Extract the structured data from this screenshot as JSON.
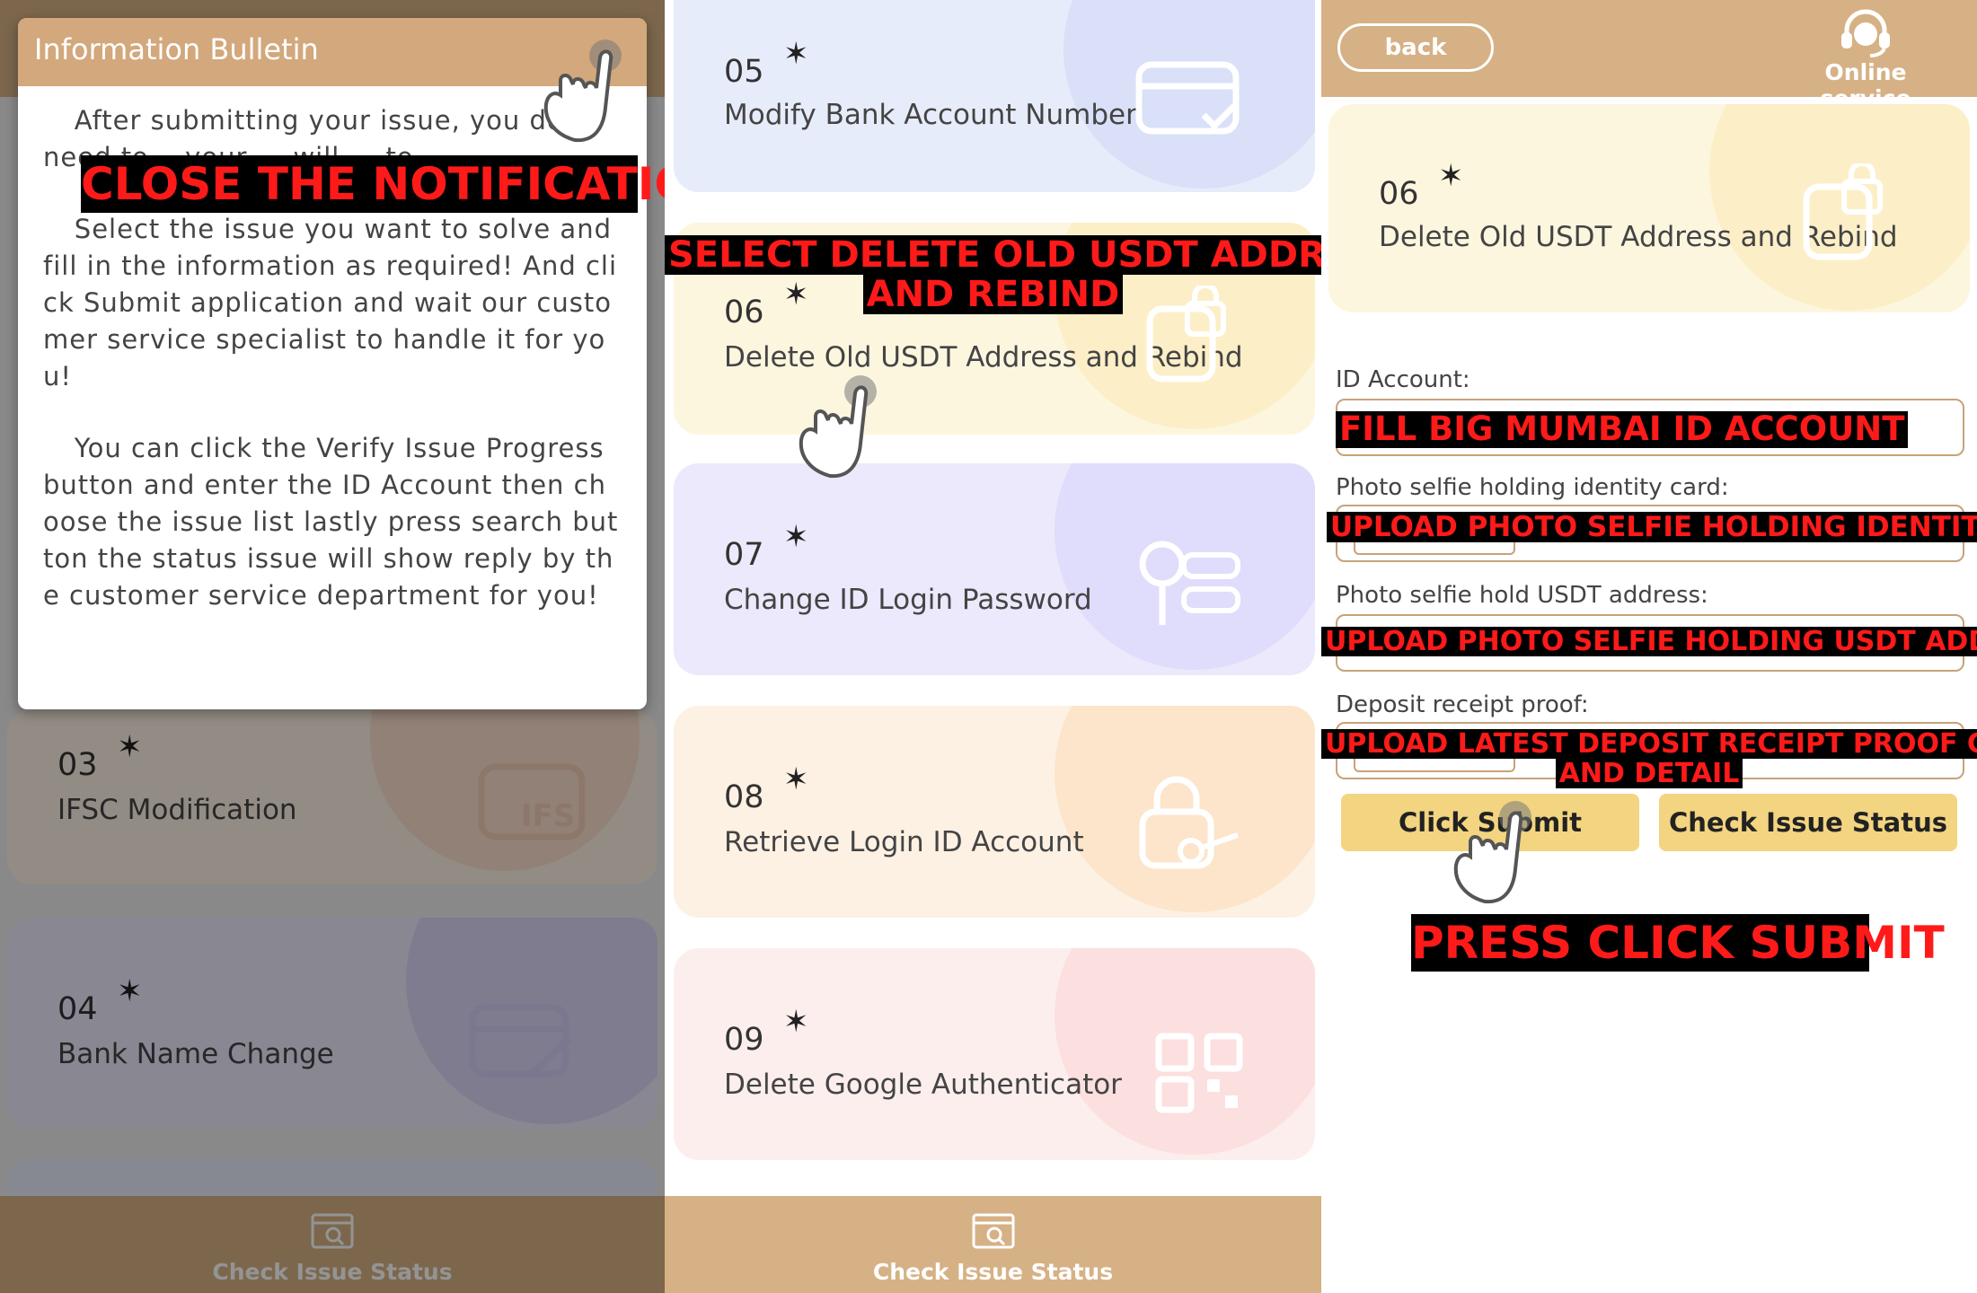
{
  "panel1": {
    "cards": [
      {
        "num": "03",
        "label": "IFSC Modification"
      },
      {
        "num": "04",
        "label": "Bank Name Change"
      }
    ],
    "bulletin": {
      "title": "Information Bulletin",
      "paragraphs": [
        "After submitting your issue, you don't need to... your ... will ... to ...",
        "Select the issue you want to solve and fill in the information as required! And click Submit application and wait our customer service specialist to handle it for you!",
        "You can click the Verify Issue Progress button and enter the ID Account then choose the issue list lastly press search button the status issue will show reply by the customer service department for you!"
      ]
    },
    "bottom_label": "Check Issue Status"
  },
  "panel2": {
    "cards": [
      {
        "num": "05",
        "label": "Modify Bank Account Number",
        "icon": "card-check-icon"
      },
      {
        "num": "06",
        "label": "Delete Old USDT Address and Rebind",
        "icon": "lock-icon"
      },
      {
        "num": "07",
        "label": "Change ID Login Password",
        "icon": "key-icon"
      },
      {
        "num": "08",
        "label": "Retrieve Login ID Account",
        "icon": "lock-key-icon"
      },
      {
        "num": "09",
        "label": "Delete Google Authenticator",
        "icon": "qr-icon"
      }
    ],
    "bottom_label": "Check Issue Status"
  },
  "panel3": {
    "back_label": "back",
    "online_label": "Online service",
    "card": {
      "num": "06",
      "label": "Delete Old USDT Address and Rebind"
    },
    "fields": {
      "id_label": "ID Account:",
      "selfie_id_label": "Photo selfie holding identity card:",
      "selfie_usdt_label": "Photo selfie hold USDT address:",
      "deposit_label": "Deposit receipt proof:"
    },
    "submit_label": "Click Submit",
    "status_label": "Check Issue Status"
  },
  "annotations": {
    "close": "CLOSE THE NOTIFICATION",
    "select_line1": "SELECT DELETE OLD USDT ADDRESS",
    "select_line2": "AND REBIND",
    "fill_id": "FILL BIG MUMBAI ID ACCOUNT",
    "upload_id": "UPLOAD PHOTO SELFIE HOLDING IDENTITY CAR",
    "upload_usdt": "UPLOAD PHOTO SELFIE HOLDING USDT ADDRESS",
    "upload_deposit_line1": "UPLOAD LATEST DEPOSIT RECEIPT PROOF CLEAR",
    "upload_deposit_line2": "AND DETAIL",
    "press_submit": "PRESS CLICK SUBMIT"
  },
  "colors": {
    "header_tan": "#d6b185",
    "annotation_red": "#ff1a1a",
    "button_yellow": "#f3d480"
  }
}
